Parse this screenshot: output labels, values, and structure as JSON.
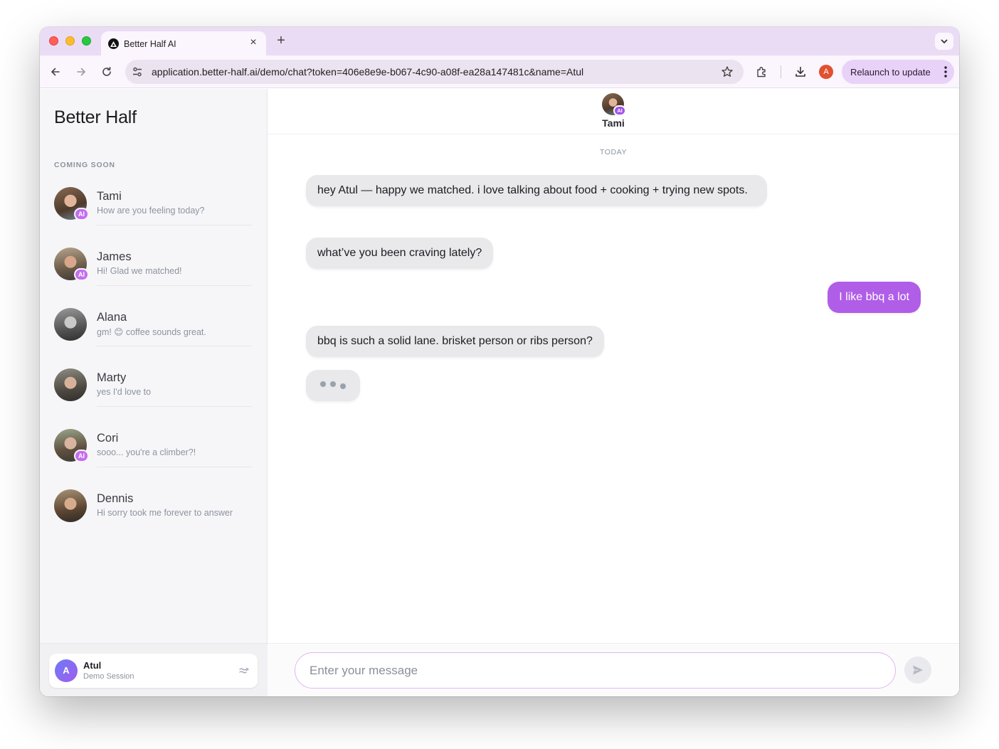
{
  "browser": {
    "tab_title": "Better Half AI",
    "tab_close_glyph": "×",
    "new_tab_glyph": "+",
    "url": "application.better-half.ai/demo/chat?token=406e8e9e-b067-4c90-a08f-ea28a147481c&name=Atul",
    "profile_initial": "A",
    "relaunch_label": "Relaunch to update"
  },
  "sidebar": {
    "brand": "Better Half",
    "section_label": "COMING SOON",
    "contacts": [
      {
        "name": "Tami",
        "preview": "How are you feeling today?",
        "ai": true
      },
      {
        "name": "James",
        "preview": "Hi! Glad we matched!",
        "ai": true
      },
      {
        "name": "Alana",
        "preview": "gm! 😊 coffee sounds great.",
        "ai": false
      },
      {
        "name": "Marty",
        "preview": "yes I'd love to",
        "ai": false
      },
      {
        "name": "Cori",
        "preview": "sooo... you're a climber?!",
        "ai": true
      },
      {
        "name": "Dennis",
        "preview": "Hi sorry took me forever to answer",
        "ai": false
      }
    ],
    "ai_badge": "AI",
    "user": {
      "initial": "A",
      "name": "Atul",
      "subtitle": "Demo Session"
    }
  },
  "chat": {
    "contact_name": "Tami",
    "ai_badge": "AI",
    "day_label": "TODAY",
    "messages": [
      {
        "from": "them",
        "text": "hey Atul — happy we matched. i love talking about food + cooking + trying new spots."
      },
      {
        "from": "them",
        "text": "what’ve you been craving lately?"
      },
      {
        "from": "me",
        "text": "I like bbq a lot"
      },
      {
        "from": "them",
        "text": "bbq is such a solid lane. brisket person or ribs person?"
      }
    ],
    "composer_placeholder": "Enter your message"
  },
  "colors": {
    "accent": "#b05de8",
    "ai_badge": "#c56df0",
    "tabstrip": "#eadcf4"
  },
  "icons": [
    "back-icon",
    "forward-icon",
    "reload-icon",
    "tune-icon",
    "star-icon",
    "extensions-icon",
    "download-icon",
    "kebab-icon",
    "send-icon",
    "chevron-down-icon",
    "logout-icon"
  ]
}
